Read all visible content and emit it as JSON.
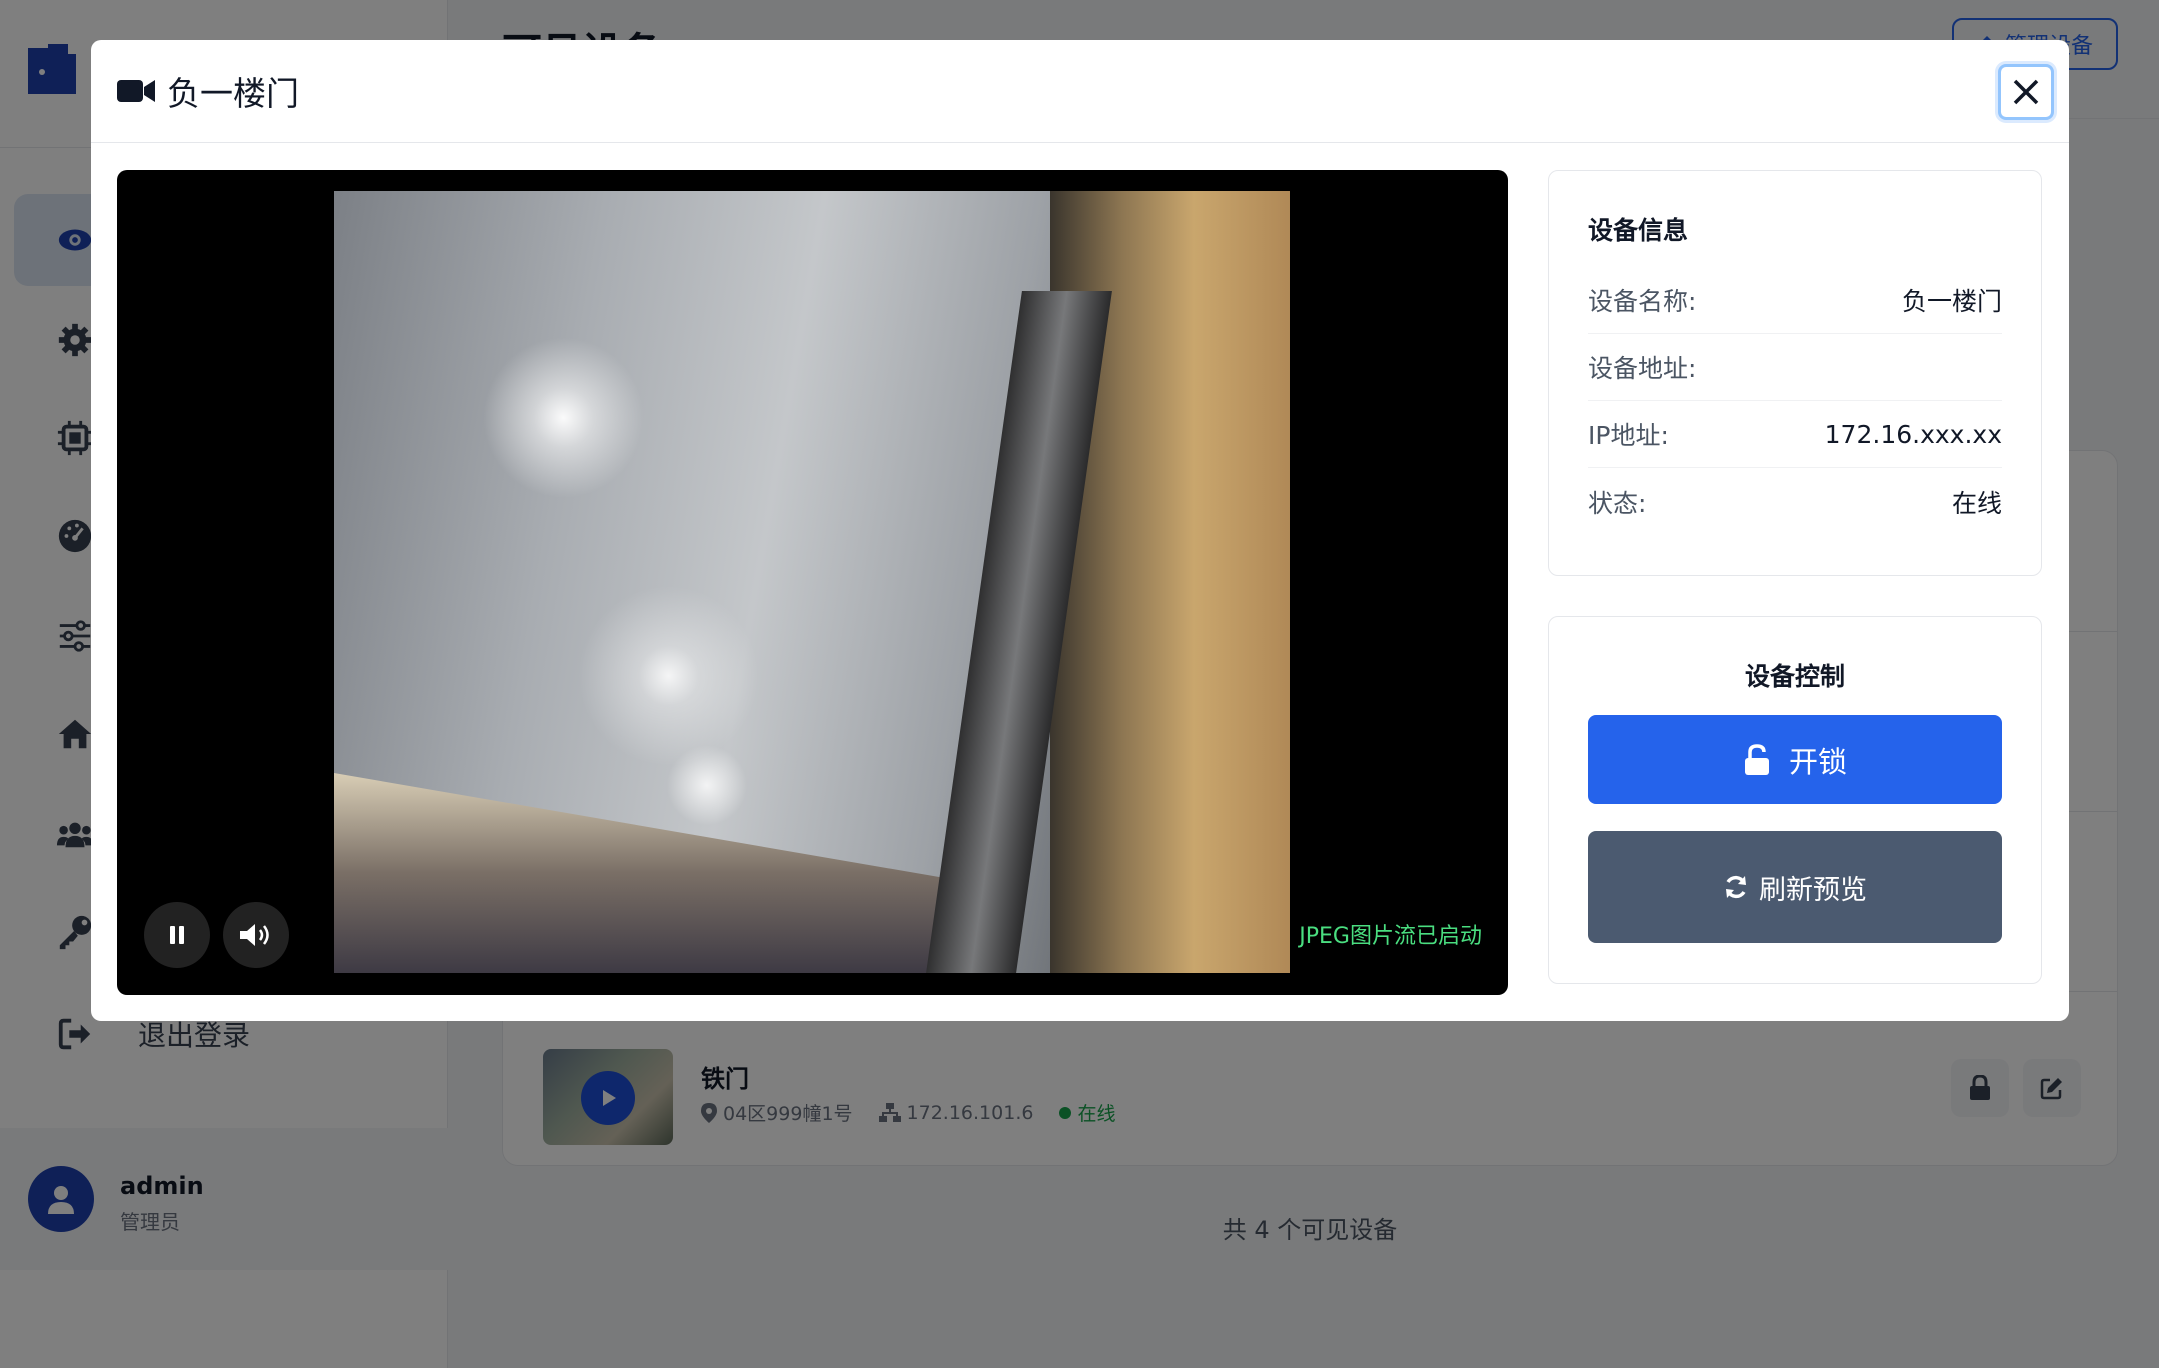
{
  "background": {
    "page_title": "可见设备",
    "manage_button": "管理设备",
    "sidebar": {
      "logout_label": "退出登录",
      "user": {
        "name": "admin",
        "role": "管理员"
      }
    },
    "device_row": {
      "name": "铁门",
      "location": "04区999幢1号",
      "ip": "172.16.101.6",
      "status": "在线"
    },
    "footer_count": "共 4 个可见设备"
  },
  "modal": {
    "title": "负一楼门",
    "stream_status": "JPEG图片流已启动",
    "device_info": {
      "title": "设备信息",
      "rows": [
        {
          "label": "设备名称:",
          "value": "负一楼门"
        },
        {
          "label": "设备地址:",
          "value": ""
        },
        {
          "label": "IP地址:",
          "value": "172.16.xxx.xx"
        },
        {
          "label": "状态:",
          "value": "在线"
        }
      ]
    },
    "device_control": {
      "title": "设备控制",
      "unlock_label": "开锁",
      "refresh_label": "刷新预览"
    }
  },
  "colors": {
    "primary": "#2563eb",
    "secondary_button": "#4b5a70",
    "online": "#16a34a",
    "stream_status": "#4ade80"
  },
  "icons": [
    "door-logo-icon",
    "eye-icon",
    "gear-icon",
    "chip-icon",
    "gauge-icon",
    "sliders-icon",
    "home-icon",
    "users-icon",
    "key-icon",
    "logout-icon",
    "user-icon",
    "video-camera-icon",
    "close-icon",
    "pause-icon",
    "volume-icon",
    "unlock-icon",
    "refresh-icon",
    "map-pin-icon",
    "network-icon",
    "lock-icon",
    "edit-icon",
    "play-icon"
  ]
}
